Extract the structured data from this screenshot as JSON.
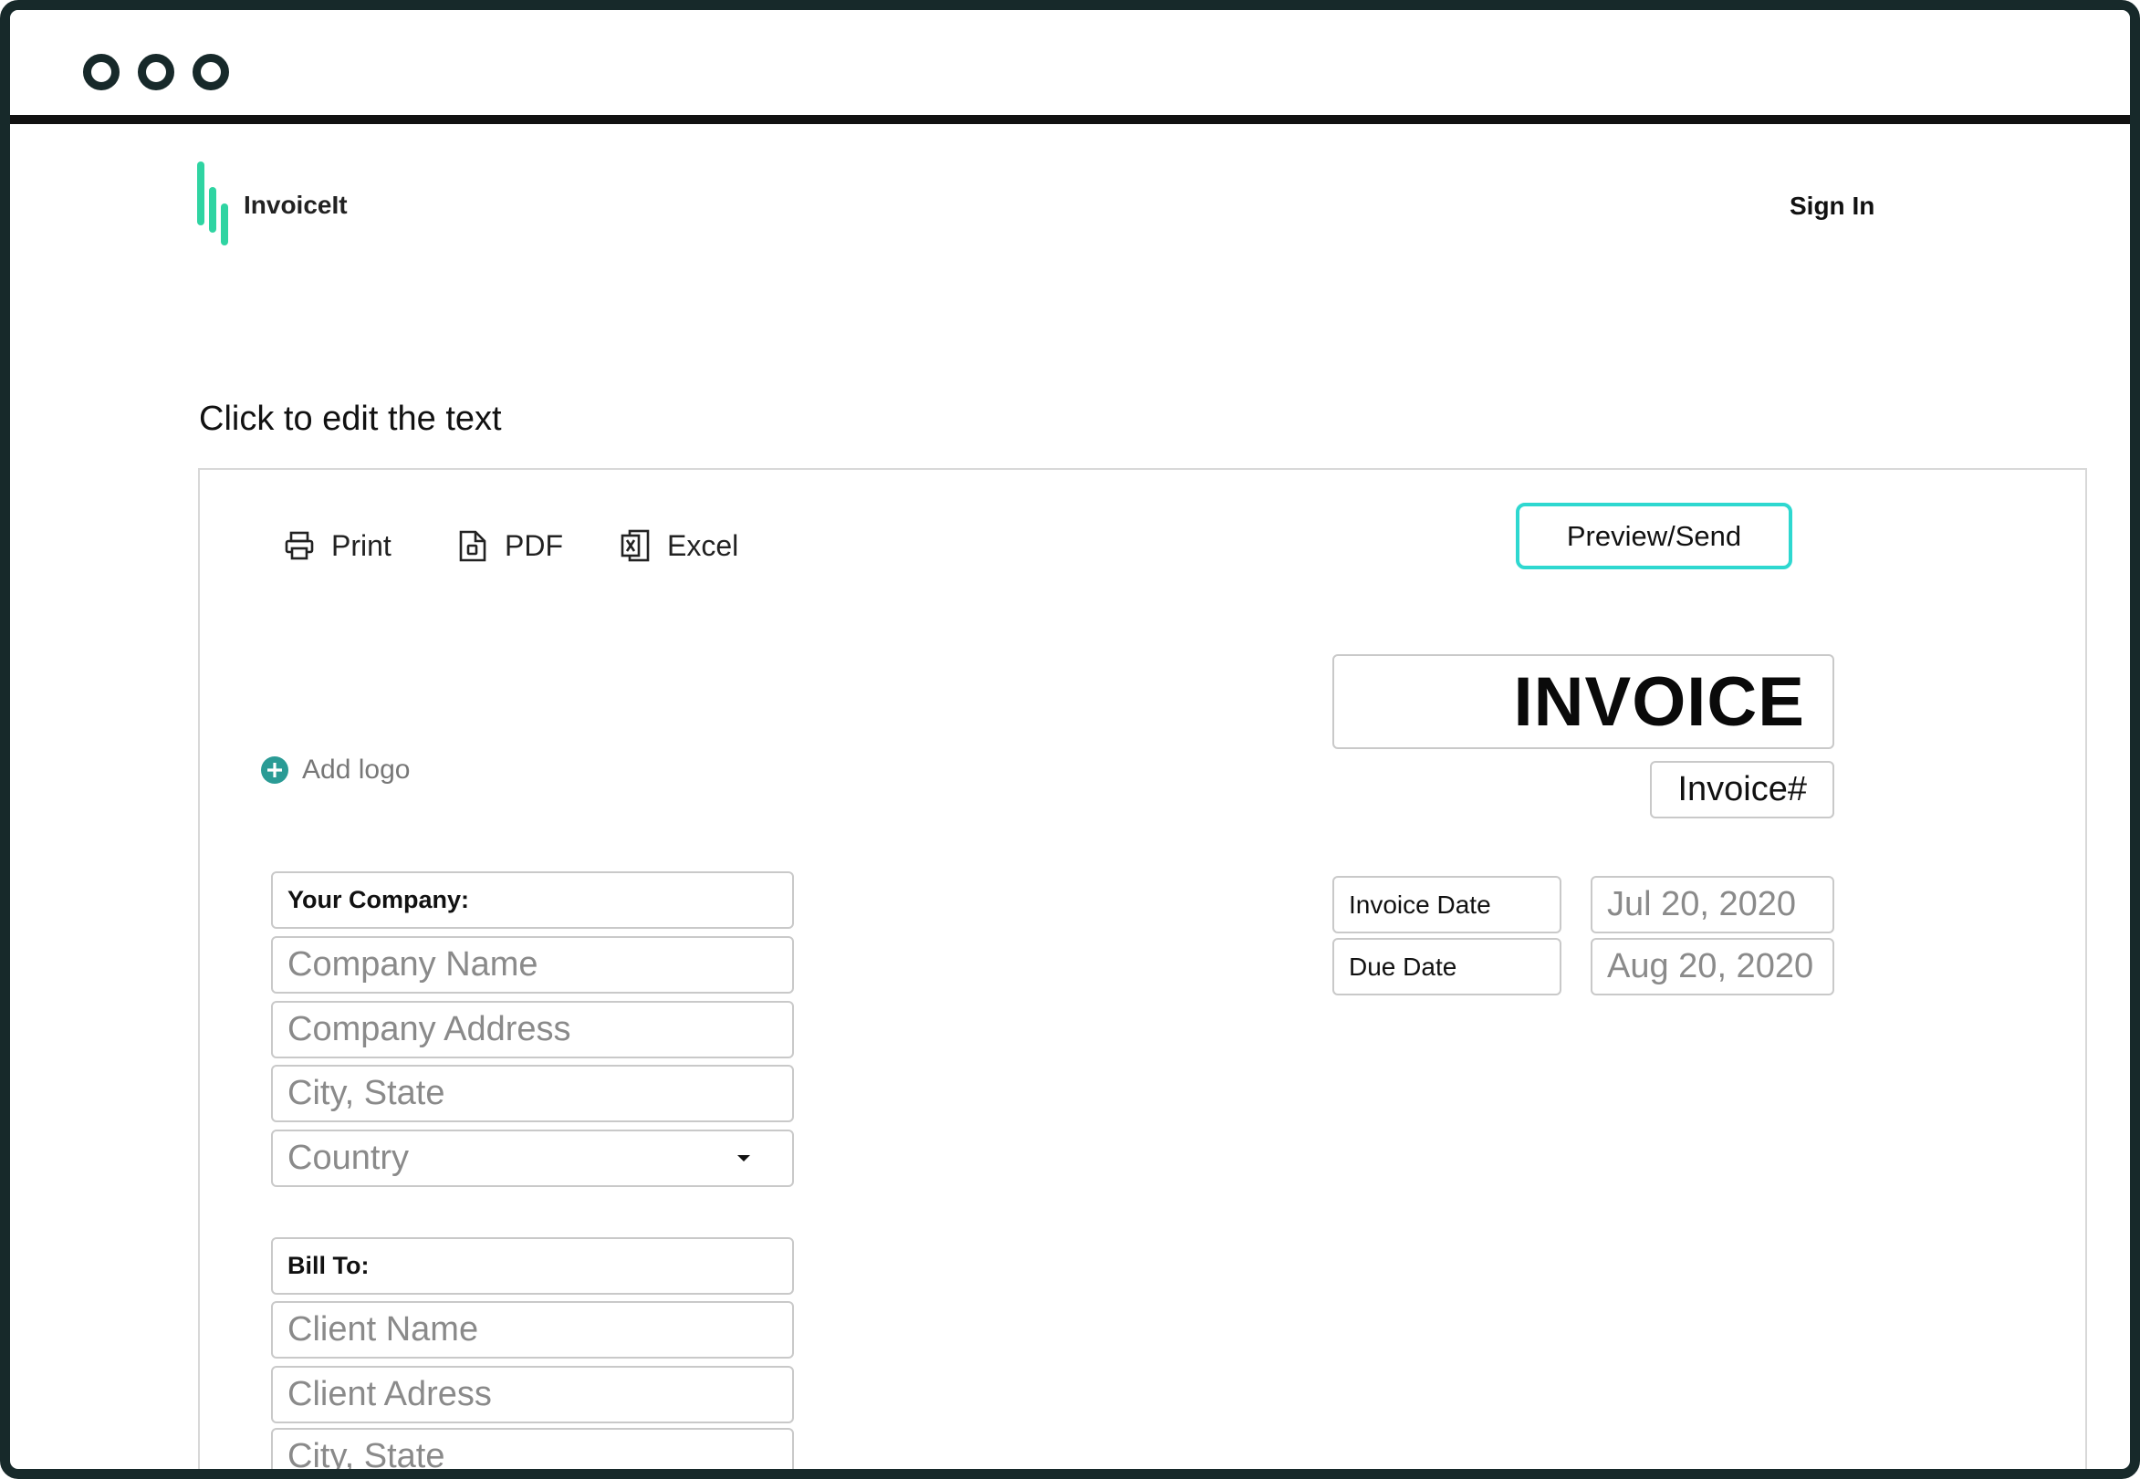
{
  "app": {
    "name": "InvoiceIt",
    "sign_in": "Sign In"
  },
  "brand": {
    "accent": "#2fd4a2",
    "button_border": "#2ed8d0",
    "frame": "#17292a"
  },
  "hint": "Click to edit the text",
  "toolbar": {
    "print": "Print",
    "pdf": "PDF",
    "excel": "Excel",
    "preview": "Preview/Send"
  },
  "add_logo": "Add logo",
  "invoice": {
    "title": "INVOICE",
    "number_placeholder": "Invoice#",
    "date_label": "Invoice Date",
    "date_value": "Jul 20, 2020",
    "due_label": "Due Date",
    "due_value": "Aug 20, 2020"
  },
  "company": {
    "heading": "Your Company:",
    "name": "Company Name",
    "address": "Company Address",
    "city": "City, State",
    "country": "Country"
  },
  "bill_to": {
    "heading": "Bill To:",
    "name": "Client Name",
    "address": "Client Adress",
    "city": "City, State"
  }
}
